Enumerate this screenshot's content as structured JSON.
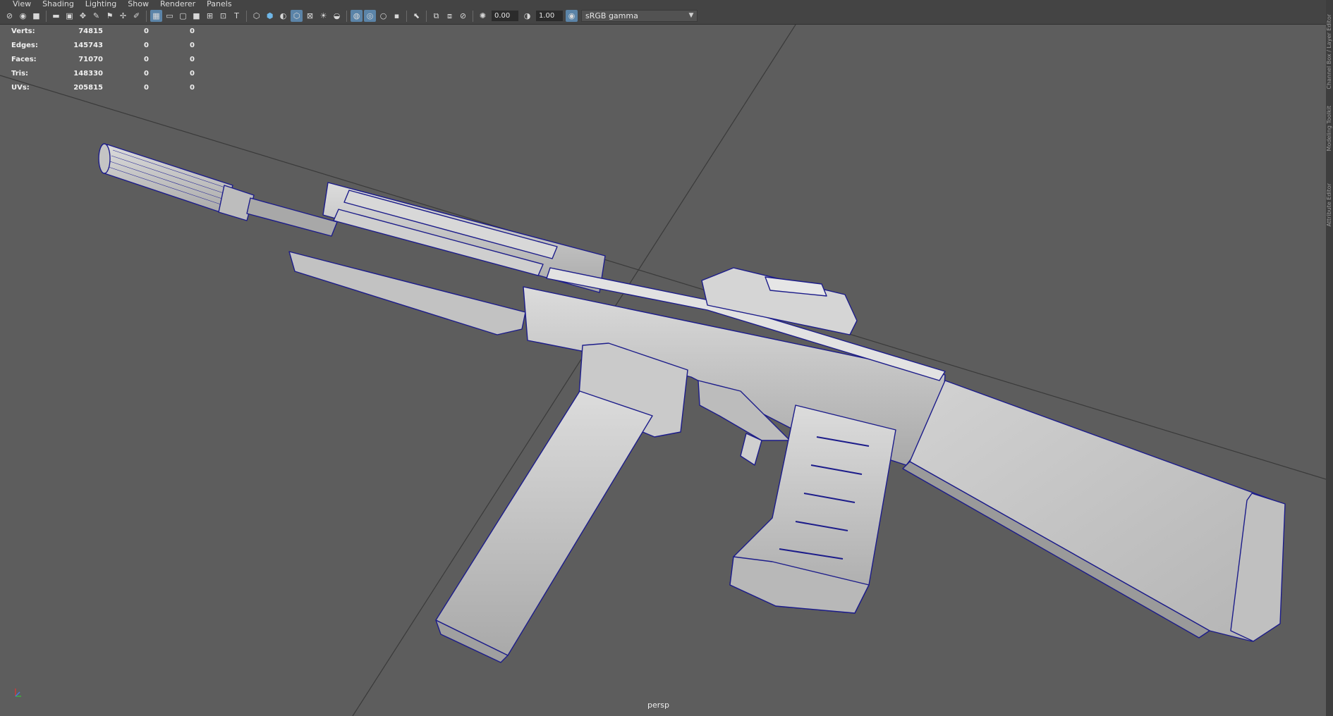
{
  "menubar": {
    "items": [
      "View",
      "Shading",
      "Lighting",
      "Show",
      "Renderer",
      "Panels"
    ]
  },
  "toolbar": {
    "exposure_value": "0.00",
    "gamma_value": "1.00",
    "color_space": "sRGB gamma"
  },
  "hud": {
    "rows": [
      {
        "label": "Verts:",
        "total": "74815",
        "selected": "0",
        "other": "0"
      },
      {
        "label": "Edges:",
        "total": "145743",
        "selected": "0",
        "other": "0"
      },
      {
        "label": "Faces:",
        "total": "71070",
        "selected": "0",
        "other": "0"
      },
      {
        "label": "Tris:",
        "total": "148330",
        "selected": "0",
        "other": "0"
      },
      {
        "label": "UVs:",
        "total": "205815",
        "selected": "0",
        "other": "0"
      }
    ]
  },
  "viewport": {
    "camera": "persp"
  },
  "right_panel": {
    "tabs": [
      "Channel Box / Layer Editor",
      "Modeling Toolkit",
      "Attribute Editor"
    ]
  },
  "colors": {
    "viewport_bg": "#5d5d5d",
    "wireframe": "#1a1a8c",
    "mesh_fill": "#c8c8c8",
    "active_button": "#5b84a8"
  }
}
